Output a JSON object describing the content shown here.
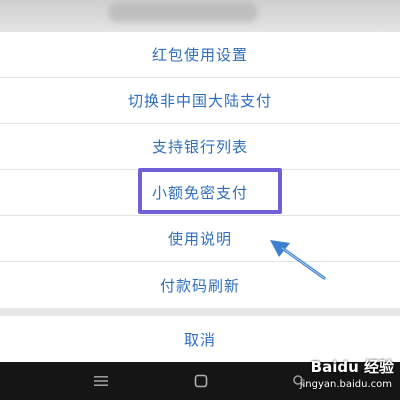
{
  "menu": {
    "items": [
      {
        "label": "红包使用设置"
      },
      {
        "label": "切换非中国大陆支付"
      },
      {
        "label": "支持银行列表"
      },
      {
        "label": "小额免密支付"
      },
      {
        "label": "使用说明"
      },
      {
        "label": "付款码刷新"
      }
    ],
    "cancel_label": "取消"
  },
  "watermark": {
    "brand": "Baidu 经验",
    "site": "jingyan.baidu.com"
  },
  "colors": {
    "menu_text": "#2f6ebd",
    "highlight": "#7060d8",
    "arrow": "#3f7fd0",
    "nav_bar": "#151515"
  },
  "icons": {
    "nav_menu": "menu-lines-icon",
    "nav_home": "home-square-icon",
    "nav_back": "back-icon",
    "annotation": "pointer-arrow-icon"
  }
}
